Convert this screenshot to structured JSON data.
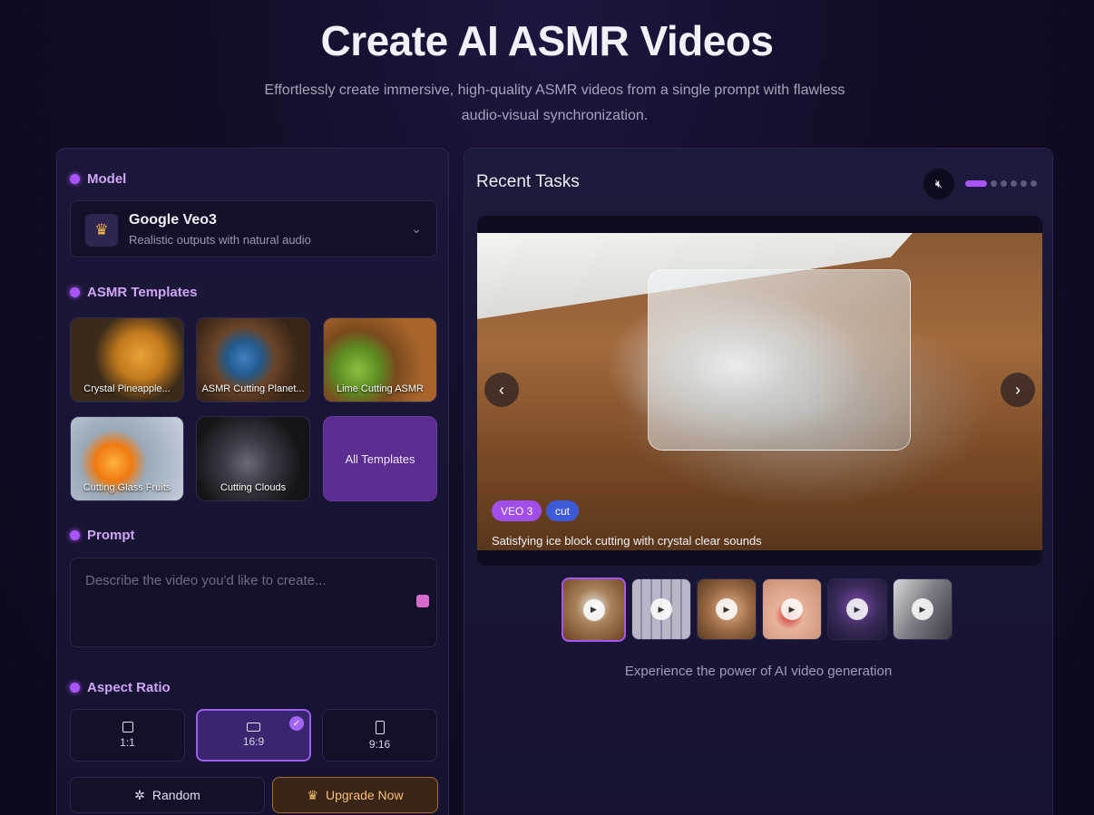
{
  "header": {
    "title": "Create AI ASMR Videos",
    "subtitle": "Effortlessly create immersive, high-quality ASMR videos from a single prompt with flawless audio-visual synchronization."
  },
  "model": {
    "section_label": "Model",
    "name": "Google Veo3",
    "description": "Realistic outputs with natural audio",
    "icon": "crown-icon"
  },
  "templates": {
    "section_label": "ASMR Templates",
    "items": [
      {
        "label": "Crystal Pineapple..."
      },
      {
        "label": "ASMR Cutting Planet..."
      },
      {
        "label": "Lime Cutting ASMR"
      },
      {
        "label": "Cutting Glass Fruits"
      },
      {
        "label": "Cutting Clouds"
      }
    ],
    "all_label": "All Templates"
  },
  "prompt": {
    "section_label": "Prompt",
    "placeholder": "Describe the video you'd like to create..."
  },
  "aspect_ratio": {
    "section_label": "Aspect Ratio",
    "options": [
      {
        "label": "1:1",
        "selected": false
      },
      {
        "label": "16:9",
        "selected": true
      },
      {
        "label": "9:16",
        "selected": false
      }
    ]
  },
  "actions": {
    "random_label": "Random",
    "upgrade_label": "Upgrade Now"
  },
  "recent": {
    "title": "Recent Tasks",
    "pager_total": 6,
    "pager_active": 1,
    "video": {
      "tags": [
        "VEO 3",
        "cut"
      ],
      "caption": "Satisfying ice block cutting with crystal clear sounds"
    },
    "thumbnail_count": 6,
    "active_thumbnail": 1,
    "footer": "Experience the power of AI video generation"
  },
  "colors": {
    "accent": "#a855f7",
    "upgrade": "#f5c074"
  }
}
